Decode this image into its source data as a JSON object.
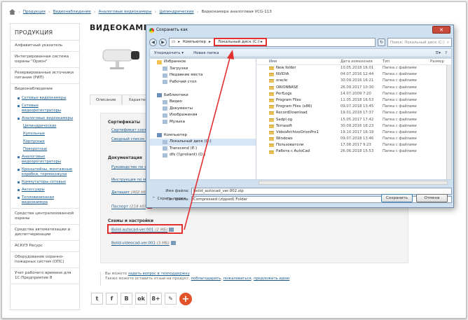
{
  "breadcrumb": {
    "items": [
      "Продукция",
      "Видеонаблюдение",
      "Аналоговые видеокамеры",
      "Цилиндрические"
    ],
    "current": "Видеокамера аналоговая VCG-113"
  },
  "sidebar": {
    "title": "ПРОДУКЦИЯ",
    "items": [
      "Алфавитный указатель",
      "Интегрированная система охраны \"Орион\"",
      "Резервированные источники питания (РИП)",
      "Видеонаблюдение"
    ],
    "subitems": [
      "Сетевые видеокамеры",
      "Сетевые видеорегистраторы",
      "Аналоговые видеокамеры"
    ],
    "subsub": [
      "Цилиндрические",
      "Купольные",
      "Корпусные",
      "Поворотные"
    ],
    "subitems2": [
      "Аналоговые видеорегистраторы",
      "Кронштейны, монтажные коробки, термокожухи",
      "Коммутаторы сетевые",
      "Аксессуары",
      "Тепловизионная видеокамера"
    ],
    "tail": [
      "Средства централизованной охраны",
      "Средства автоматизации и диспетчеризации",
      "АСКУЭ Ресурс",
      "Оборудование охранно-пожарных систем (ОПС)",
      "Учет рабочего времени для 1С:Предприятие 8"
    ]
  },
  "main": {
    "title": "ВИДЕОКАМЕРА АНАЛОГОВАЯ VCG-113",
    "tabs": [
      "Описание",
      "Характеристики"
    ]
  },
  "content": {
    "certs_h": "Сертификаты",
    "certs": [
      "Сертификат соответствия",
      "Сводный список сертификатов"
    ],
    "docs_h": "Документация",
    "docs": [
      {
        "t": "Руководство по эксплуатации",
        "s": ""
      },
      {
        "t": "Инструкция по монтажу",
        "s": ""
      },
      {
        "t": "Даташит",
        "s": "(402 kб)"
      },
      {
        "t": "Паспорт",
        "s": "(218 kб)"
      }
    ],
    "schemes_h": "Схемы и настройки",
    "schemes": [
      {
        "t": "Bolid-autocad-ver.001",
        "s": "(2 МБ)"
      },
      {
        "t": "Bolid-videocad-ver.001",
        "s": "(3 МБ)"
      }
    ]
  },
  "feedback": {
    "line1_pre": "Вы можете ",
    "line1_link": "задать вопрос в техподдержку",
    "line2_pre": "Также можете оставить отзыв на продукт, ",
    "line2_link1": "поблагодарить",
    "line2_link2": "пожаловаться",
    "line2_link3": "предложить идею"
  },
  "social": [
    "t",
    "f",
    "B",
    "ok",
    "8+",
    "✎",
    "+"
  ],
  "dialog": {
    "title": "Сохранить как",
    "addr_root": "Компьютер",
    "addr_current": "Локальный диск (C:)",
    "search_placeholder": "Поиск: Локальный диск (C:)",
    "toolbar": {
      "organize": "Упорядочить ▾",
      "new_folder": "Новая папка"
    },
    "tree": [
      "Избранное",
      "Загрузки",
      "Недавние места",
      "Рабочий стол",
      "",
      "Библиотеки",
      "Видео",
      "Документы",
      "Изображения",
      "Музыка",
      "",
      "Компьютер",
      "Локальный диск (C:)",
      "Transcend (E:)",
      "dfs (\\\\proliant) (Q:)"
    ],
    "columns": [
      "Имя",
      "Дата изменения",
      "Тип",
      "Размер"
    ],
    "files": [
      [
        "New folder",
        "10.05.2018 16:01",
        "Папка с файлами"
      ],
      [
        "NVIDIA",
        "04.07.2016 12:44",
        "Папка с файлами"
      ],
      [
        "oracle",
        "30.09.2016 16:21",
        "Папка с файлами"
      ],
      [
        "ORIONBASE",
        "26.09.2017 10:30",
        "Папка с файлами"
      ],
      [
        "PerfLogs",
        "14.07.2009 7:20",
        "Папка с файлами"
      ],
      [
        "Program Files",
        "11.05.2018 16:53",
        "Папка с файлами"
      ],
      [
        "Program Files (x86)",
        "09.07.2018 13:45",
        "Папка с файлами"
      ],
      [
        "RecordDownload",
        "19.01.2018 17:37",
        "Папка с файлами"
      ],
      [
        "Sadpl.og",
        "15.05.2017 17:42",
        "Папка с файлами"
      ],
      [
        "Terrasoft",
        "30.09.2016 16:23",
        "Папка с файлами"
      ],
      [
        "VideoArchiveOrionPro1",
        "19.10.2017 16:19",
        "Папка с файлами"
      ],
      [
        "Windows",
        "09.07.2018 13:46",
        "Папка с файлами"
      ],
      [
        "Пользователи",
        "17.08.2017 9:23",
        "Папка с файлами"
      ],
      [
        "Работа с AutoCad",
        "26.06.2018 15:53",
        "Папка с файлами"
      ]
    ],
    "filename_label": "Имя файла:",
    "filename": "Bolid_autocad_ver.002.zip",
    "type_label": "Тип файла:",
    "type": "Compressed (zipped) Folder",
    "hide": "Скрыть папки",
    "save": "Сохранить",
    "cancel": "Отмена"
  }
}
